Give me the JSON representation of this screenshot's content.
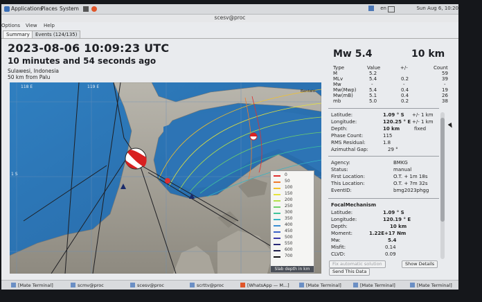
{
  "topbar": {
    "menus": [
      "Applications",
      "Places",
      "System"
    ],
    "lang": "en",
    "datetime": "Sun Aug 6, 10:20"
  },
  "window": {
    "title": "scesv@proc"
  },
  "app_menu": [
    "Options",
    "View",
    "Help"
  ],
  "tabs": [
    {
      "label": "Summary",
      "active": true
    },
    {
      "label": "Events (124/135)",
      "active": false
    }
  ],
  "event": {
    "origin_time": "2023-08-06 10:09:23 UTC",
    "ago": "10 minutes and 54 seconds ago",
    "region": "Sulawesi, Indonesia",
    "nearest": "50 km from Palu",
    "magnitude": "Mw 5.4",
    "depth": "10 km"
  },
  "magnitudes": {
    "headers": [
      "Type",
      "Value",
      "+/-",
      "Count"
    ],
    "rows": [
      [
        "M",
        "5.2",
        "",
        "59"
      ],
      [
        "MLv",
        "5.4",
        "0.2",
        "39"
      ],
      [
        "Mw",
        "-",
        "-",
        "-"
      ],
      [
        "Mw(Mwp)",
        "5.4",
        "0.4",
        "19"
      ],
      [
        "Mw(mB)",
        "5.1",
        "0.4",
        "26"
      ],
      [
        "mb",
        "5.0",
        "0.2",
        "38"
      ]
    ]
  },
  "origin": {
    "latitude_label": "Latitude:",
    "latitude": "1.09 ° S",
    "latitude_err": "+/-  1 km",
    "longitude_label": "Longitude:",
    "longitude": "120.25 ° E",
    "longitude_err": "+/-  1 km",
    "depth_label": "Depth:",
    "depth": "10 km",
    "depth_flag": "fixed",
    "phase_label": "Phase Count:",
    "phase": "115",
    "rms_label": "RMS Residual:",
    "rms": "1.8",
    "gap_label": "Azimuthal Gap:",
    "gap": "29 °"
  },
  "source": {
    "agency_label": "Agency:",
    "agency": "BMKG",
    "status_label": "Status:",
    "status": "manual",
    "first_label": "First Location:",
    "first": "O.T. + 1m 18s",
    "this_label": "This Location:",
    "this": "O.T. + 7m 32s",
    "eventid_label": "EventID:",
    "eventid": "bmg2023phgg"
  },
  "focal": {
    "title": "FocalMechanism",
    "latitude_label": "Latitude:",
    "latitude": "1.09 ° S",
    "longitude_label": "Longitude:",
    "longitude": "120.19 ° E",
    "depth_label": "Depth:",
    "depth": "10 km",
    "moment_label": "Moment:",
    "moment": "1.22E+17 Nm",
    "mw_label": "Mw:",
    "mw": "5.4",
    "misfit_label": "Misfit:",
    "misfit": "0.14",
    "clvd_label": "CLVD:",
    "clvd": "0.09"
  },
  "map": {
    "lon_labels": [
      "118 E",
      "119 E"
    ],
    "lat_label": "1 S",
    "place_label": "Bentalo"
  },
  "legend": {
    "title": "Slab depth in km",
    "entries": [
      {
        "label": "0",
        "color": "#e03030"
      },
      {
        "label": "50",
        "color": "#f07a2a"
      },
      {
        "label": "100",
        "color": "#f2c22a"
      },
      {
        "label": "150",
        "color": "#e6e43a"
      },
      {
        "label": "200",
        "color": "#b4e04a"
      },
      {
        "label": "250",
        "color": "#6fd06a"
      },
      {
        "label": "300",
        "color": "#3ec39a"
      },
      {
        "label": "350",
        "color": "#36b4c4"
      },
      {
        "label": "400",
        "color": "#3a8fd4"
      },
      {
        "label": "450",
        "color": "#3a62c8"
      },
      {
        "label": "500",
        "color": "#3a3aa8"
      },
      {
        "label": "550",
        "color": "#2a2a78"
      },
      {
        "label": "600",
        "color": "#1e1e4a"
      },
      {
        "label": "700",
        "color": "#111111"
      }
    ]
  },
  "buttons": {
    "fix_solution": "Fix automatic solution",
    "send": "Send This Data",
    "details": "Show Details"
  },
  "taskbar": [
    "[Mate Terminal]",
    "scmv@proc",
    "scesv@proc",
    "scrttv@proc",
    "[WhatsApp — M...]",
    "[Mate Terminal]",
    "[Mate Terminal]",
    "[Mate Terminal]"
  ]
}
